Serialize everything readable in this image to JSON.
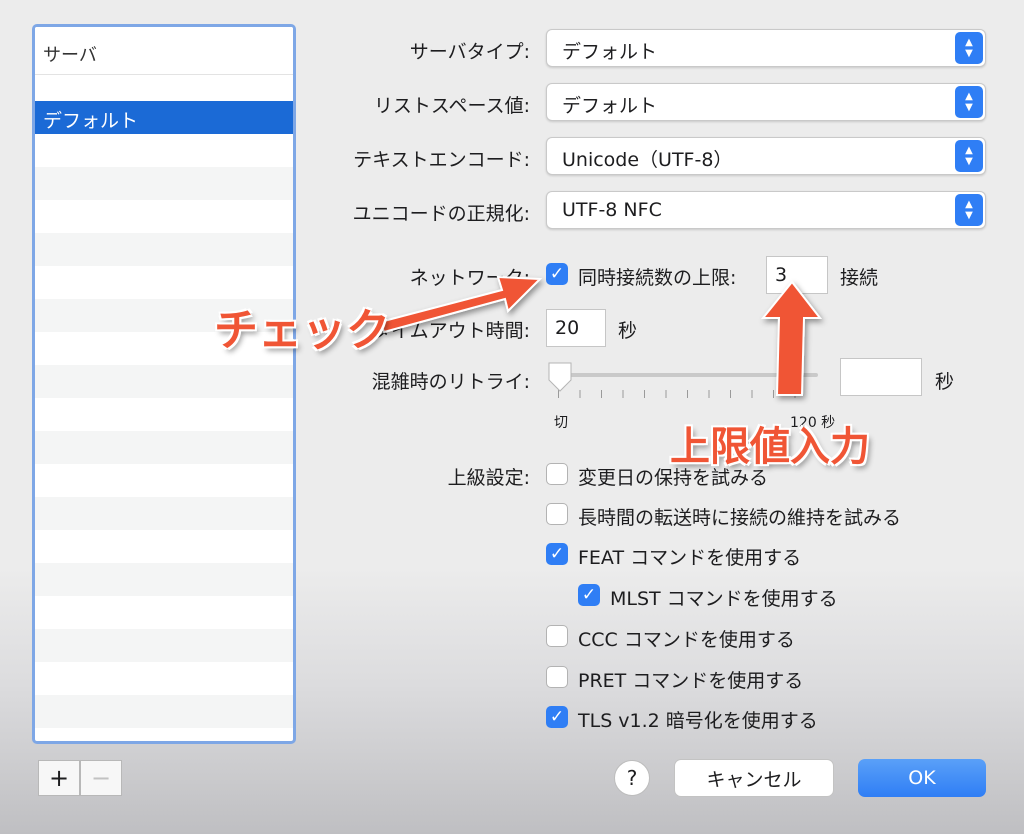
{
  "server_list": {
    "header": "サーバ",
    "items": [
      "デフォルト"
    ],
    "add_label": "+",
    "remove_label": "−"
  },
  "form": {
    "server_type": {
      "label": "サーバタイプ:",
      "value": "デフォルト"
    },
    "list_space": {
      "label": "リストスペース値:",
      "value": "デフォルト"
    },
    "text_encoding": {
      "label": "テキストエンコード:",
      "value": "Unicode（UTF-8）"
    },
    "unicode_normalization": {
      "label": "ユニコードの正規化:",
      "value": "UTF-8 NFC"
    },
    "network": {
      "label": "ネットワーク:",
      "limit_connections": {
        "label": "同時接続数の上限:",
        "checked": true
      },
      "connections_value": "3",
      "connections_unit": "接続"
    },
    "timeout": {
      "label": "タイムアウト時間:",
      "value": "20",
      "unit": "秒"
    },
    "retry": {
      "label": "混雑時のリトライ:",
      "value": "",
      "unit": "秒",
      "slider_min": "切",
      "slider_max": "120 秒",
      "slider_level": 0
    },
    "advanced": {
      "label": "上級設定:",
      "options": [
        {
          "label": "変更日の保持を試みる",
          "checked": false
        },
        {
          "label": "長時間の転送時に接続の維持を試みる",
          "checked": false
        },
        {
          "label": "FEAT コマンドを使用する",
          "checked": true
        },
        {
          "label": "MLST コマンドを使用する",
          "checked": true
        },
        {
          "label": "CCC コマンドを使用する",
          "checked": false
        },
        {
          "label": "PRET コマンドを使用する",
          "checked": false
        },
        {
          "label": "TLS v1.2 暗号化を使用する",
          "checked": true
        }
      ]
    }
  },
  "buttons": {
    "help": "?",
    "cancel": "キャンセル",
    "ok": "OK"
  },
  "annotations": {
    "check": "チェック",
    "limit_input": "上限値入力",
    "color": "#f05535"
  },
  "icons": {
    "check": "✓",
    "stepper_up": "▲",
    "stepper_down": "▼"
  }
}
